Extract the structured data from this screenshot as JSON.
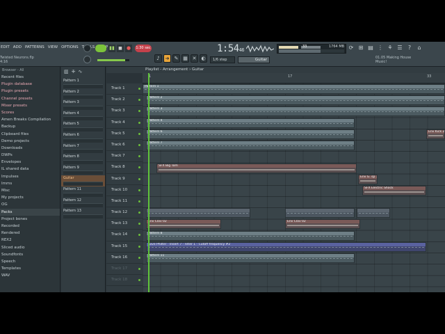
{
  "menu": [
    "EDIT",
    "ADD",
    "PATTERNS",
    "VIEW",
    "OPTIONS",
    "TOOLS",
    "HELP"
  ],
  "project": {
    "name": "Twisted Neurons.flp",
    "sub": "4:16"
  },
  "transport": {
    "pattern_label": "1:30 sec",
    "song_time": "1:54",
    "song_time_sub": "46"
  },
  "cpu": {
    "value": "33",
    "memory": "1764 MB",
    "voices": "0"
  },
  "snap": "1/6 step",
  "channel": "Guitar",
  "news": {
    "date": "01.05",
    "text": "Making House",
    "text2": "Music!"
  },
  "browser": {
    "header": "Browser - All",
    "items": [
      {
        "label": "Recent files",
        "style": "normal"
      },
      {
        "label": "Plugin database",
        "style": "hl"
      },
      {
        "label": "Plugin presets",
        "style": "hl"
      },
      {
        "label": "Channel presets",
        "style": "hl"
      },
      {
        "label": "Mixer presets",
        "style": "hl"
      },
      {
        "label": "Scores",
        "style": "hl"
      },
      {
        "label": "Amen Breaks Compilation",
        "style": "normal"
      },
      {
        "label": "Backup",
        "style": "normal"
      },
      {
        "label": "Clipboard files",
        "style": "normal"
      },
      {
        "label": "Demo projects",
        "style": "normal"
      },
      {
        "label": "Downloads",
        "style": "normal"
      },
      {
        "label": "DWPs",
        "style": "normal"
      },
      {
        "label": "Envelopes",
        "style": "normal"
      },
      {
        "label": "IL shared data",
        "style": "normal"
      },
      {
        "label": "Impulses",
        "style": "normal"
      },
      {
        "label": "Imms",
        "style": "normal"
      },
      {
        "label": "Misc",
        "style": "normal"
      },
      {
        "label": "My projects",
        "style": "normal"
      },
      {
        "label": "OG",
        "style": "normal"
      },
      {
        "label": "Packs",
        "style": "sel"
      },
      {
        "label": "Project bones",
        "style": "normal"
      },
      {
        "label": "Recorded",
        "style": "normal"
      },
      {
        "label": "Rendered",
        "style": "normal"
      },
      {
        "label": "REX2",
        "style": "normal"
      },
      {
        "label": "Sliced audio",
        "style": "normal"
      },
      {
        "label": "Soundfonts",
        "style": "normal"
      },
      {
        "label": "Speech",
        "style": "normal"
      },
      {
        "label": "Templates",
        "style": "normal"
      },
      {
        "label": "WAV",
        "style": "normal"
      }
    ]
  },
  "patterns": [
    "Pattern 1",
    "Pattern 2",
    "Pattern 3",
    "Pattern 4",
    "Pattern 5",
    "Pattern 6",
    "Pattern 7",
    "Pattern 8",
    "Pattern 9",
    "Guitar",
    "Pattern 11",
    "Pattern 12",
    "Pattern 13"
  ],
  "playlist": {
    "title": "Playlist - Arrangement › Guitar",
    "ruler_marks": [
      "1",
      "17",
      "33"
    ],
    "tracks": [
      "Track 1",
      "Track 2",
      "Track 3",
      "Track 4",
      "Track 5",
      "Track 6",
      "Track 7",
      "Track 8",
      "Track 9",
      "Track 10",
      "Track 11",
      "Track 12",
      "Track 13",
      "Track 14",
      "Track 15",
      "Track 16",
      "Track 17",
      "Track 18"
    ],
    "clips": {
      "pattern1": "Pattern 1",
      "pattern2": "Pattern 2",
      "pattern3": "Pattern 3",
      "pattern4": "Pattern 4",
      "pattern6": "Pattern 6",
      "pattern7": "Pattern 7",
      "kick": "Env Kick 2",
      "sfx_big": "SFX Big Tom",
      "sfx_env": "Env G. sp 13",
      "sfx_electric": "SFX Electric Shock",
      "clav1": "Env Clav 02",
      "clav2": "Env Clav 02",
      "pattern8": "Pattern 8",
      "auto": "Love Philter - Insert 7 - Filter 1 - Cutoff frequency #2",
      "pattern11": "Pattern 11"
    }
  }
}
